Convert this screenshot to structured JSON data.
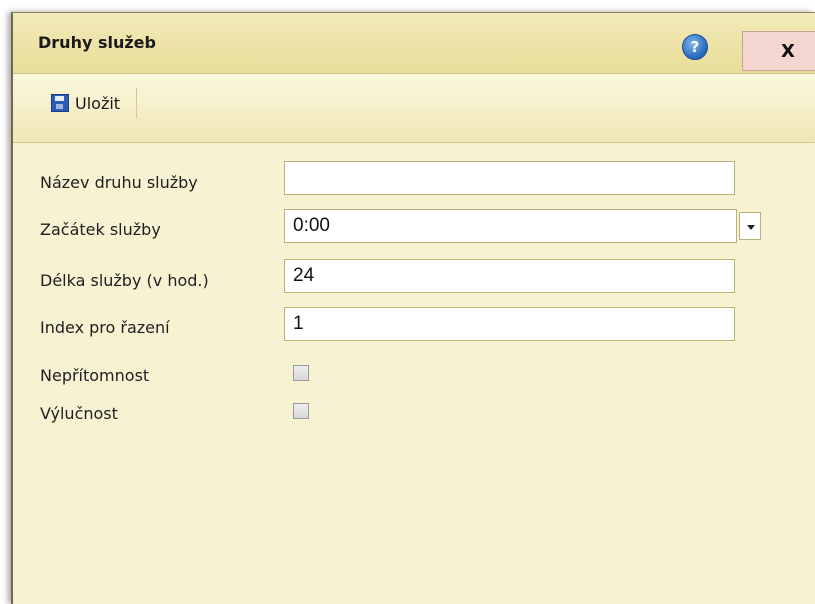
{
  "dialog": {
    "title": "Druhy služeb",
    "help_label": "?",
    "close_label": "X"
  },
  "toolbar": {
    "save_label": "Uložit"
  },
  "form": {
    "name_label": "Název druhu služby",
    "name_value": "",
    "start_label": "Začátek služby",
    "start_value": "0:00",
    "length_label": "Délka služby (v hod.)",
    "length_value": "24",
    "index_label": "Index pro řazení",
    "index_value": "1",
    "absence_label": "Nepřítomnost",
    "absence_checked": false,
    "exclusive_label": "Výlučnost",
    "exclusive_checked": false
  },
  "icons": {
    "help": "help-icon",
    "close": "close-icon",
    "save": "floppy-disk-icon",
    "dropdown": "chevron-down-icon"
  },
  "colors": {
    "background": "#f7f3d2",
    "titlebar": "#e9dd99",
    "close_button": "#f2d6cf",
    "help_icon": "#2a6cc0"
  }
}
